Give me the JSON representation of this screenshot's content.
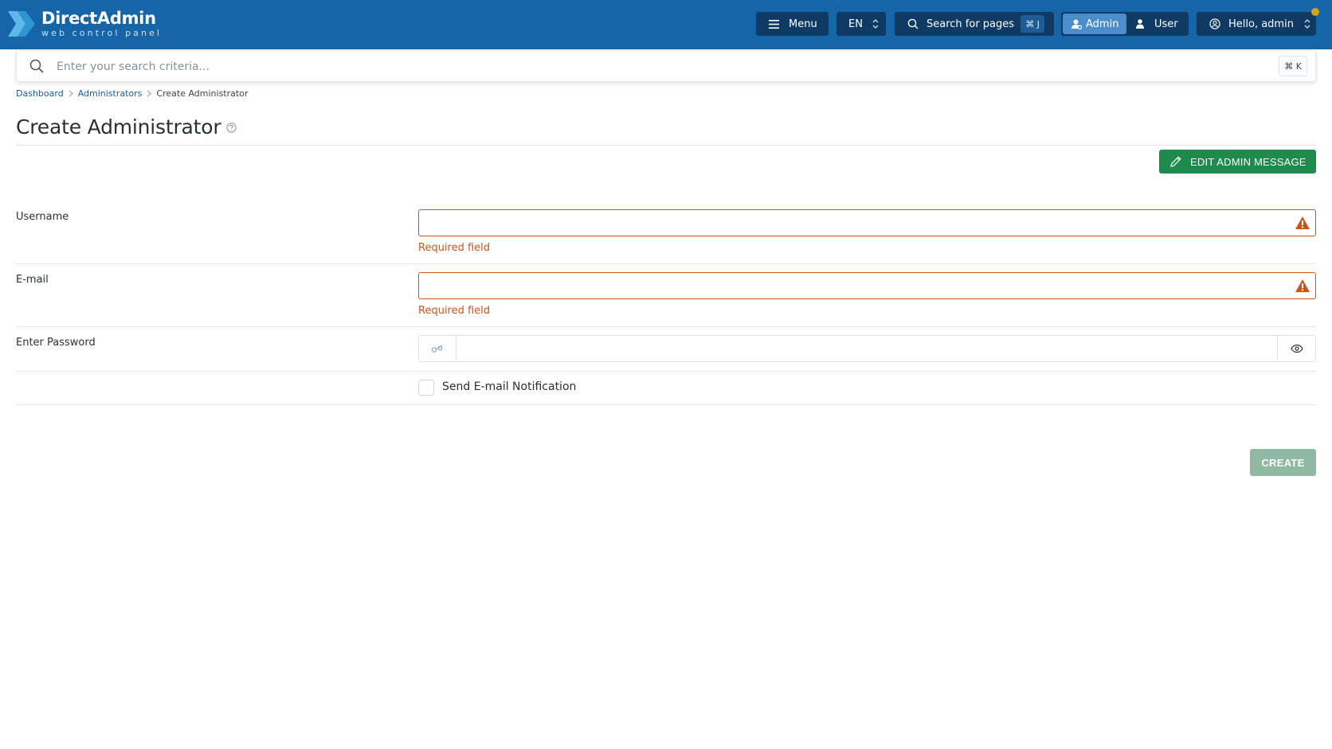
{
  "app": {
    "brand_name": "DirectAdmin",
    "brand_tagline": "web control panel",
    "colors": {
      "topbar": "#1565a8",
      "accent": "#1e8a4c",
      "error": "#c9551a"
    }
  },
  "topbar": {
    "menu_label": "Menu",
    "lang_value": "EN",
    "search_pages_label": "Search for pages",
    "search_pages_shortcut": "⌘ J",
    "role_admin_label": "Admin",
    "role_user_label": "User",
    "active_role": "Admin",
    "greeting": "Hello, admin"
  },
  "search": {
    "placeholder": "Enter your search criteria...",
    "shortcut": "⌘ K"
  },
  "breadcrumb": {
    "items": [
      "Dashboard",
      "Administrators",
      "Create Administrator"
    ]
  },
  "page": {
    "title": "Create Administrator",
    "edit_message_label": "EDIT ADMIN MESSAGE"
  },
  "form": {
    "username": {
      "label": "Username",
      "value": "",
      "error": "Required field"
    },
    "email": {
      "label": "E-mail",
      "value": "",
      "error": "Required field"
    },
    "password": {
      "label": "Enter Password",
      "value": ""
    },
    "notify": {
      "label": "Send E-mail Notification",
      "checked": false
    },
    "submit_label": "CREATE"
  }
}
